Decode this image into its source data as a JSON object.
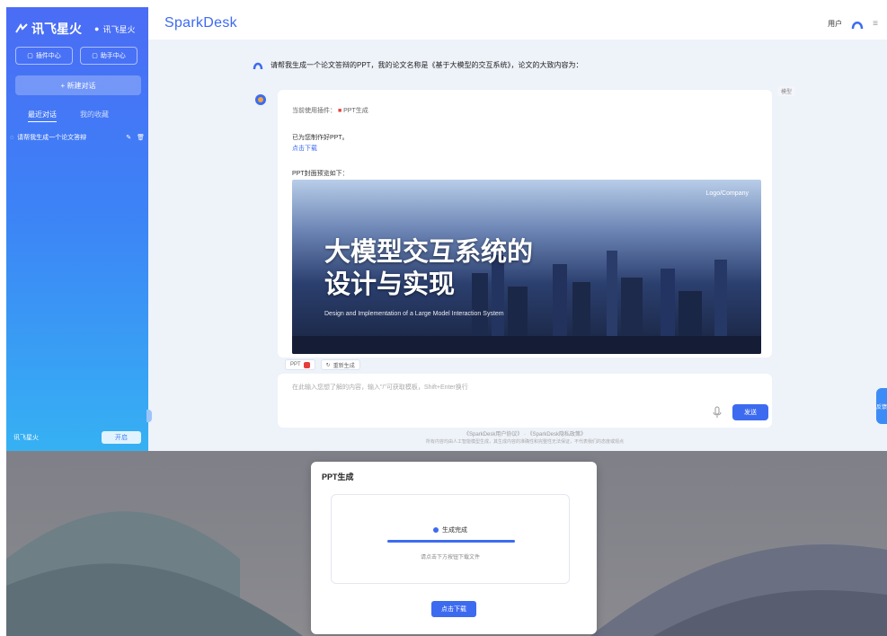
{
  "sidebar": {
    "logo_text": "讯飞星火",
    "logo_sub": "讯飞星火",
    "btn_plugins": "插件中心",
    "btn_assistant": "助手中心",
    "new_chat": "+ 新建对话",
    "tab_recent": "最近对话",
    "tab_fav": "我的收藏",
    "history": [
      {
        "title": "请帮我生成一个论文答辩"
      }
    ],
    "bottom_label": "讯飞星火",
    "toggle_label": "开启"
  },
  "header": {
    "brand": "SparkDesk",
    "user_label": "用户"
  },
  "chat": {
    "question": "请帮我生成一个论文答辩的PPT，我的论文名称是《基于大模型的交互系统》，论文的大致内容为：",
    "model_tag": "模型",
    "plugin_line_prefix": "当前使用插件：",
    "plugin_name": "PPT生成",
    "line_done": "已为您制作好PPT。",
    "line_download": "点击下载",
    "line_preview": "PPT封面预览如下：",
    "cover": {
      "title_line1": "大模型交互系统的",
      "title_line2": "设计与实现",
      "subtitle": "Design and Implementation of a Large Model Interaction System",
      "company": "Logo/Company"
    },
    "chip_ppt": "PPT",
    "chip_regen": "重新生成"
  },
  "input": {
    "placeholder": "在此输入您想了解的内容，输入\"/\"可获取模板，Shift+Enter换行",
    "send_label": "发送"
  },
  "footer": {
    "links": "《SparkDesk用户协议》 · 《SparkDesk隐私政策》",
    "note": "所有内容均由人工智能模型生成，其生成内容的准确性和完整性无法保证，不代表我们的态度或观点"
  },
  "float_label": "反馈",
  "modal": {
    "title": "PPT生成",
    "status": "生成完成",
    "progress": 1.0,
    "hint": "请点击下方按钮下载文件",
    "download_label": "点击下载"
  },
  "colors": {
    "accent": "#3d6bf0",
    "sidebar_top": "#4b6cf5",
    "sidebar_bottom": "#36b1f3",
    "ppt_red": "#e83c3c"
  }
}
